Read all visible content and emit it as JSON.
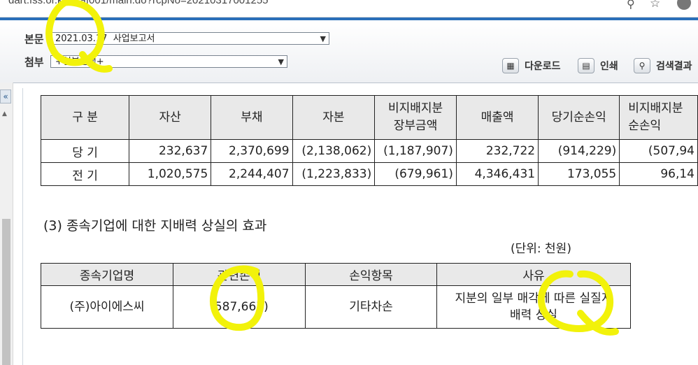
{
  "browser": {
    "url": "dart.fss.or.kr/dsaf001/main.do?rcpNo=20210317001255"
  },
  "toolbar": {
    "body_label": "본문",
    "body_select_value": "2021.03.17  사업보고서",
    "attach_label": "첨부",
    "attach_select_value": "+첨부선택+",
    "download_label": "다운로드",
    "print_label": "인쇄",
    "search_result_label": "검색결과"
  },
  "table1": {
    "headers": [
      "구     분",
      "자산",
      "부채",
      "자본",
      "비지배지분\n장부금액",
      "매출액",
      "당기순손익",
      "비지배지분\n순손익"
    ],
    "rows": [
      [
        "당 기",
        "232,637",
        "2,370,699",
        "(2,138,062)",
        "(1,187,907)",
        "232,722",
        "(914,229)",
        "(507,94"
      ],
      [
        "전 기",
        "1,020,575",
        "2,244,407",
        "(1,223,833)",
        "(679,961)",
        "4,346,431",
        "173,055",
        "96,14"
      ]
    ]
  },
  "section": {
    "title": "(3) 종속기업에 대한 지배력 상실의 효과",
    "unit": "(단위: 천원)"
  },
  "table2": {
    "headers": [
      "종속기업명",
      "관련손익",
      "손익항목",
      "사유"
    ],
    "row": [
      "(주)아이에스씨",
      "(587,667)",
      "기타차손",
      "지분의 일부 매각에 따른 실질지\n배력 상실"
    ]
  },
  "annotation": {
    "color": "#f2f20a",
    "text": "Q"
  }
}
